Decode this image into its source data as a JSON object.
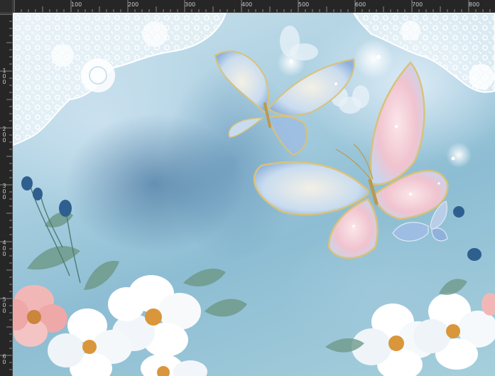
{
  "ruler": {
    "top_labels": [
      "100",
      "200",
      "300",
      "400",
      "500",
      "600",
      "700",
      "800"
    ],
    "left_labels": [
      "1\n0\n0",
      "2\n0\n0",
      "3\n0\n0",
      "4\n0\n0",
      "5\n0\n0",
      "6\n0"
    ]
  },
  "canvas": {
    "image_subject": "watercolor",
    "palette": {
      "sky": "#a9cfe0",
      "deep": "#2c5c8c",
      "lace": "#ffffff",
      "butterfly_pink": "#f3c8d2",
      "butterfly_gold": "#d9c27a",
      "flower": "#ffffff",
      "leaf": "#6f9a8a"
    }
  }
}
